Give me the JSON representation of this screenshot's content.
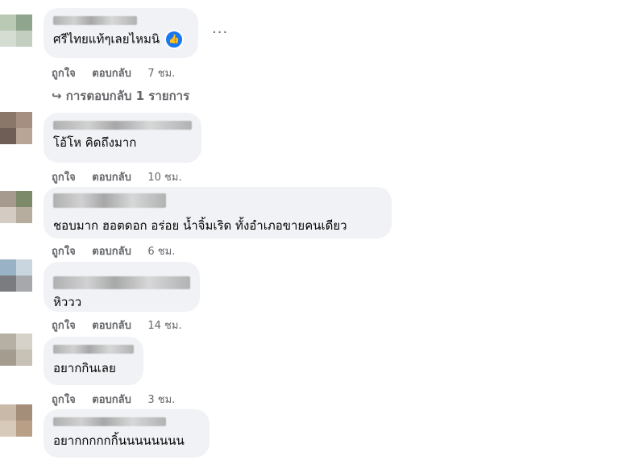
{
  "comments": [
    {
      "text": "ศรีไทยแท้ๆเลยไหมนิ",
      "like": "ถูกใจ",
      "reply": "ตอบกลับ",
      "time": "7 ชม.",
      "reaction_icon": "like-icon"
    },
    {
      "text": "โอ้โห คิดถึงมาก",
      "like": "ถูกใจ",
      "reply": "ตอบกลับ",
      "time": "10 ชม."
    },
    {
      "text": "ชอบมาก ฮอตดอก อร่อย น้ำจิ้มเริด ทั้งอำเภอขายคนเดียว",
      "like": "ถูกใจ",
      "reply": "ตอบกลับ",
      "time": "6 ชม."
    },
    {
      "text": "หิววว",
      "like": "ถูกใจ",
      "reply": "ตอบกลับ",
      "time": "14 ชม."
    },
    {
      "text": "อยากกินเลย",
      "like": "ถูกใจ",
      "reply": "ตอบกลับ",
      "time": "3 ชม."
    },
    {
      "text": "อยากกกกกกิ้นนนนนนนน"
    }
  ],
  "replies_link": "↪ การตอบกลับ 1 รายการ",
  "more_menu": "···",
  "colors": {
    "bubble": "#f0f2f5",
    "meta": "#65676b",
    "accent": "#1877f2"
  }
}
